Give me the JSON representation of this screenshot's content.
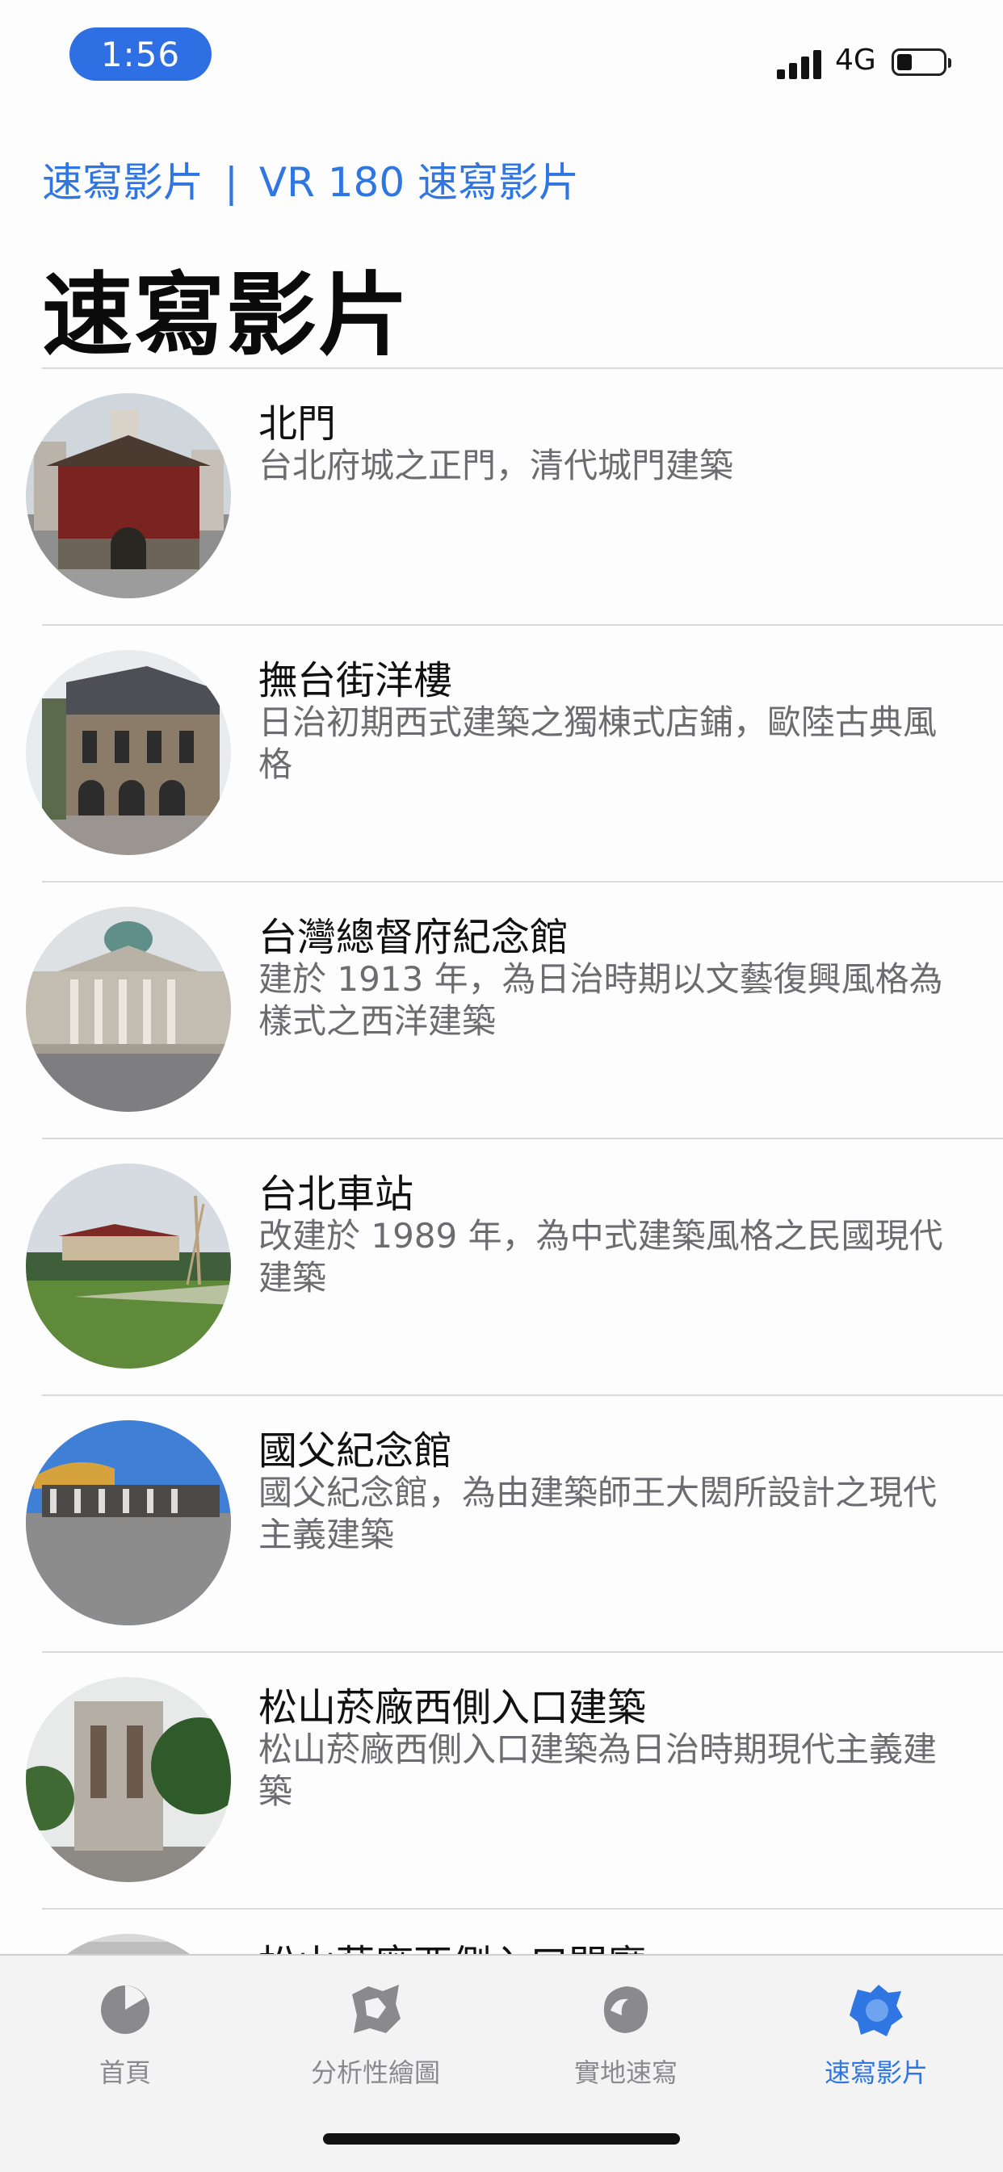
{
  "status_bar": {
    "time": "1:56",
    "network": "4G"
  },
  "top_links": {
    "sketch_video": "速寫影片",
    "separator": "|",
    "vr_video": "VR 180 速寫影片"
  },
  "page_title": "速寫影片",
  "items": [
    {
      "title": "北門",
      "description": "台北府城之正門，清代城門建築"
    },
    {
      "title": "撫台街洋樓",
      "description": "日治初期西式建築之獨棟式店鋪，歐陸古典風格"
    },
    {
      "title": "台灣總督府紀念館",
      "description": "建於 1913 年，為日治時期以文藝復興風格為樣式之西洋建築"
    },
    {
      "title": "台北車站",
      "description": "改建於 1989 年，為中式建築風格之民國現代建築"
    },
    {
      "title": "國父紀念館",
      "description": "國父紀念館，為由建築師王大閎所設計之現代主義建築"
    },
    {
      "title": "松山菸廠西側入口建築",
      "description": "松山菸廠西側入口建築為日治時期現代主義建築"
    },
    {
      "title": "松山菸廠西側入口門廳",
      "description": ""
    }
  ],
  "tab_bar": {
    "tabs": [
      {
        "label": "首頁",
        "icon": "pie-chart-icon"
      },
      {
        "label": "分析性繪圖",
        "icon": "map-outline-icon"
      },
      {
        "label": "實地速寫",
        "icon": "sketch-blob-icon"
      },
      {
        "label": "速寫影片",
        "icon": "video-splash-icon"
      }
    ],
    "active_index": 3,
    "active_color": "#2f76e3",
    "inactive_color": "#8a8a8e"
  }
}
